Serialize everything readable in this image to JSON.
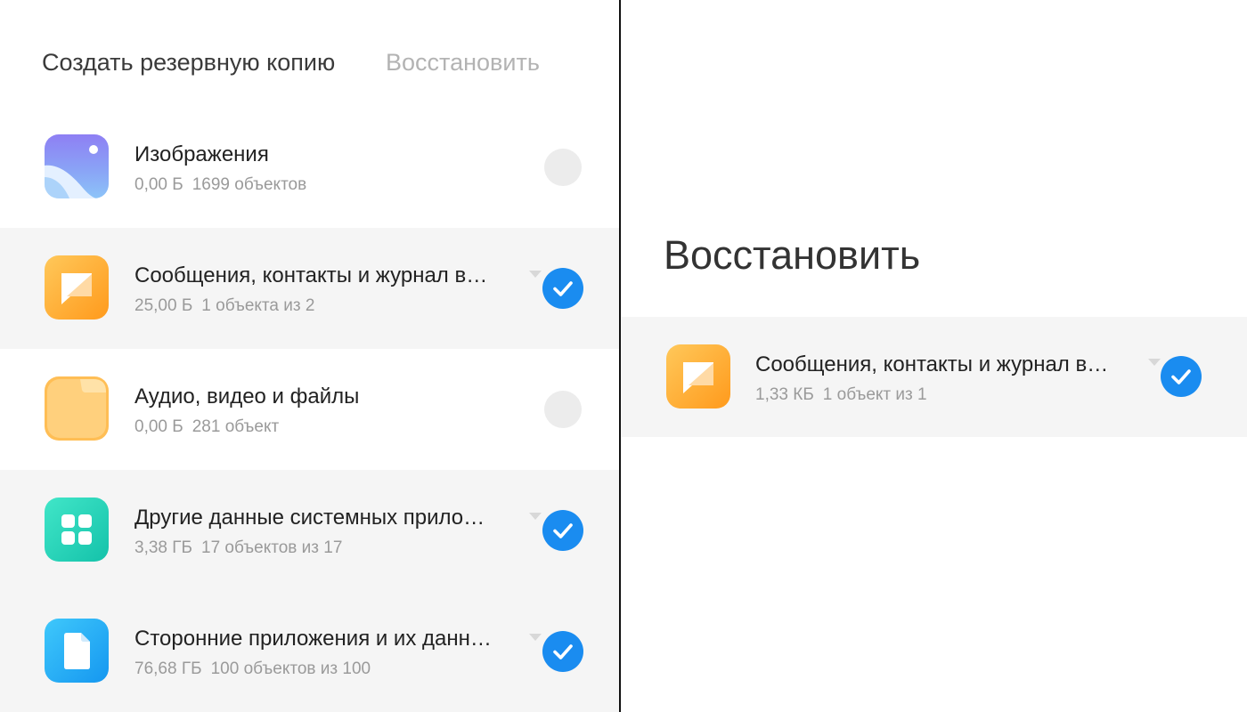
{
  "colors": {
    "accent": "#1a8cf0",
    "selected_row": "#f5f5f5",
    "divider": "#111111"
  },
  "backup": {
    "tabs": [
      {
        "label": "Создать резервную копию",
        "active": true
      },
      {
        "label": "Восстановить",
        "active": false
      }
    ],
    "items": [
      {
        "icon": "gallery-icon",
        "title": "Изображения",
        "size": "0,00 Б",
        "count": "1699 объектов",
        "checked": false,
        "expandable": false
      },
      {
        "icon": "messages-icon",
        "title": "Сообщения, контакты и журнал в…",
        "size": "25,00 Б",
        "count": "1 объекта из 2",
        "checked": true,
        "expandable": true
      },
      {
        "icon": "folder-icon",
        "title": "Аудио, видео и файлы",
        "size": "0,00 Б",
        "count": "281 объект",
        "checked": false,
        "expandable": false
      },
      {
        "icon": "system-apps-grid-icon",
        "title": "Другие данные системных прило…",
        "size": "3,38 ГБ",
        "count": "17 объектов из 17",
        "checked": true,
        "expandable": true
      },
      {
        "icon": "app-document-icon",
        "title": "Сторонние приложения и их данн…",
        "size": "76,68 ГБ",
        "count": "100 объектов из 100",
        "checked": true,
        "expandable": true
      }
    ]
  },
  "restore": {
    "title": "Восстановить",
    "items": [
      {
        "icon": "messages-icon",
        "title": "Сообщения, контакты и журнал в…",
        "size": "1,33 КБ",
        "count": "1 объект из 1",
        "checked": true,
        "expandable": true
      }
    ]
  }
}
